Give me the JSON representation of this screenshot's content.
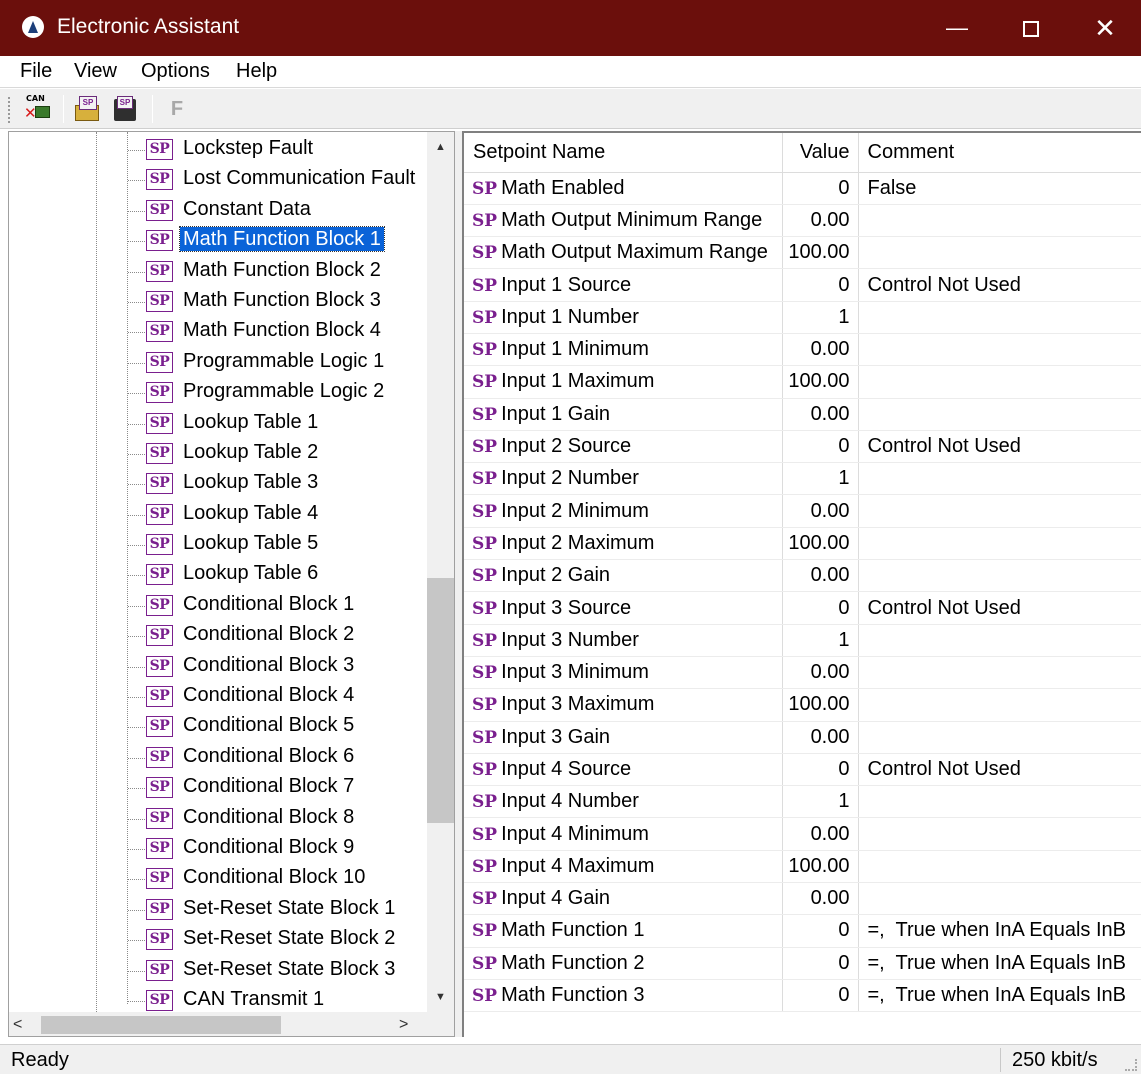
{
  "window": {
    "title": "Electronic Assistant",
    "controls": {
      "minimize": "—",
      "close": "✕"
    }
  },
  "menu": [
    "File",
    "View",
    "Options",
    "Help"
  ],
  "toolbar": {
    "can_label": "CAN",
    "sp_label": "SP",
    "f_label": "F"
  },
  "tree": {
    "icon_label": "SP",
    "selected_index": 3,
    "items": [
      "Lockstep Fault",
      "Lost Communication Fault",
      "Constant Data",
      "Math Function Block 1",
      "Math Function Block 2",
      "Math Function Block 3",
      "Math Function Block 4",
      "Programmable Logic 1",
      "Programmable Logic 2",
      "Lookup Table 1",
      "Lookup Table 2",
      "Lookup Table 3",
      "Lookup Table 4",
      "Lookup Table 5",
      "Lookup Table 6",
      "Conditional Block 1",
      "Conditional Block 2",
      "Conditional Block 3",
      "Conditional Block 4",
      "Conditional Block 5",
      "Conditional Block 6",
      "Conditional Block 7",
      "Conditional Block 8",
      "Conditional Block 9",
      "Conditional Block 10",
      "Set-Reset State Block 1",
      "Set-Reset State Block 2",
      "Set-Reset State Block 3",
      "CAN Transmit 1"
    ],
    "scroll_up": "▲",
    "scroll_down": "▼",
    "scroll_left": "<",
    "scroll_right": ">"
  },
  "grid": {
    "columns": [
      "Setpoint Name",
      "Value",
      "Comment"
    ],
    "row_tag": "SP",
    "rows": [
      {
        "name": "Math Enabled",
        "value": "0",
        "comment": "False"
      },
      {
        "name": "Math Output Minimum Range",
        "value": "0.00",
        "comment": ""
      },
      {
        "name": "Math Output Maximum Range",
        "value": "100.00",
        "comment": ""
      },
      {
        "name": "Input 1 Source",
        "value": "0",
        "comment": "Control Not Used"
      },
      {
        "name": "Input 1 Number",
        "value": "1",
        "comment": ""
      },
      {
        "name": "Input 1 Minimum",
        "value": "0.00",
        "comment": ""
      },
      {
        "name": "Input 1 Maximum",
        "value": "100.00",
        "comment": ""
      },
      {
        "name": "Input 1 Gain",
        "value": "0.00",
        "comment": ""
      },
      {
        "name": "Input 2 Source",
        "value": "0",
        "comment": "Control Not Used"
      },
      {
        "name": "Input 2 Number",
        "value": "1",
        "comment": ""
      },
      {
        "name": "Input 2 Minimum",
        "value": "0.00",
        "comment": ""
      },
      {
        "name": "Input 2 Maximum",
        "value": "100.00",
        "comment": ""
      },
      {
        "name": "Input 2 Gain",
        "value": "0.00",
        "comment": ""
      },
      {
        "name": "Input 3 Source",
        "value": "0",
        "comment": "Control Not Used"
      },
      {
        "name": "Input 3 Number",
        "value": "1",
        "comment": ""
      },
      {
        "name": "Input 3 Minimum",
        "value": "0.00",
        "comment": ""
      },
      {
        "name": "Input 3 Maximum",
        "value": "100.00",
        "comment": ""
      },
      {
        "name": "Input 3 Gain",
        "value": "0.00",
        "comment": ""
      },
      {
        "name": "Input 4 Source",
        "value": "0",
        "comment": "Control Not Used"
      },
      {
        "name": "Input 4 Number",
        "value": "1",
        "comment": ""
      },
      {
        "name": "Input 4 Minimum",
        "value": "0.00",
        "comment": ""
      },
      {
        "name": "Input 4 Maximum",
        "value": "100.00",
        "comment": ""
      },
      {
        "name": "Input 4 Gain",
        "value": "0.00",
        "comment": ""
      },
      {
        "name": "Math Function 1",
        "value": "0",
        "comment": "=,  True when InA Equals InB"
      },
      {
        "name": "Math Function 2",
        "value": "0",
        "comment": "=,  True when InA Equals InB"
      },
      {
        "name": "Math Function 3",
        "value": "0",
        "comment": "=,  True when InA Equals InB"
      }
    ]
  },
  "status": {
    "left": "Ready",
    "right": "250 kbit/s"
  },
  "colors": {
    "titlebar": "#6b0f0c",
    "selection": "#0a63d8",
    "sp_icon": "#7a1f8e"
  }
}
